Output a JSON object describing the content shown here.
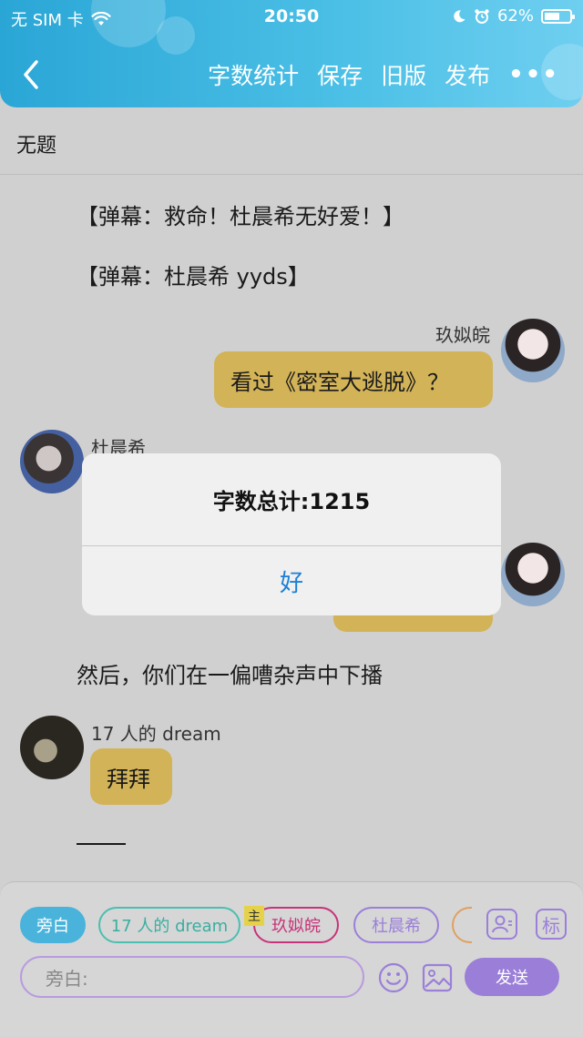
{
  "status_bar": {
    "carrier": "无 SIM 卡",
    "time": "20:50",
    "battery": "62%",
    "battery_level": 0.62
  },
  "header": {
    "back_icon": "chevron-left-icon",
    "actions": {
      "word_count": "字数统计",
      "save": "保存",
      "old_version": "旧版",
      "publish": "发布",
      "more": "•••"
    }
  },
  "document": {
    "title": "无题"
  },
  "story": {
    "narration_1": "【弹幕：救命！杜晨希无好爱！】",
    "narration_2": "【弹幕：杜晨希 yyds】",
    "msg1": {
      "name": "玖姒皖",
      "text": "看过《密室大逃脱》？"
    },
    "msg2": {
      "name": "杜晨希"
    },
    "narration_3": "然后，你们在一偏嘈杂声中下播",
    "msg4": {
      "name": "17 人的 dream",
      "text": "拜拜"
    },
    "dash": "——"
  },
  "alert": {
    "message": "字数总计:1215",
    "ok": "好"
  },
  "toolbar": {
    "chips": {
      "narrator": "旁白",
      "dream": "17 人的 dream",
      "main_badge": "主",
      "jiusiwan": "玖姒皖",
      "duchenxi": "杜晨希"
    },
    "person_icon": "person-card-icon",
    "tag_label": "标",
    "input_placeholder": "旁白:",
    "emoji_icon": "smiley-icon",
    "image_icon": "image-icon",
    "send": "发送"
  },
  "colors": {
    "header_blue": "#2aa6d6",
    "bubble_gold": "#d2b358",
    "purple": "#9a7ed8",
    "alert_blue": "#1a7fd6"
  }
}
